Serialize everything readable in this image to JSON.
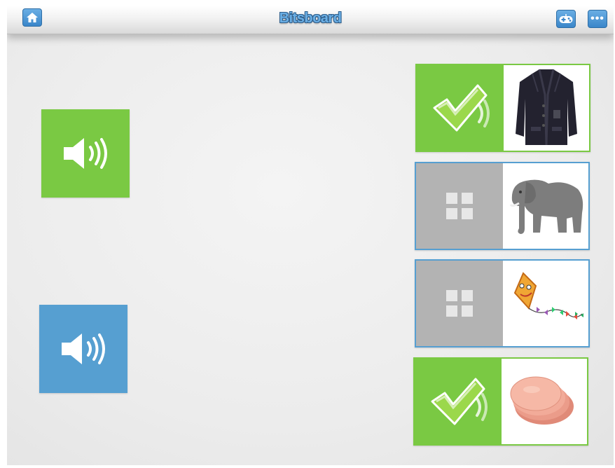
{
  "app": {
    "title": "Bitsboard",
    "toolbar": {
      "home_icon": "home-icon",
      "game_icon": "gamepad-icon",
      "more_icon": "ellipsis-icon",
      "more_label": "•••"
    }
  },
  "colors": {
    "accent_green": "#7ac943",
    "accent_blue": "#569fd1",
    "pending_gray": "#b3b3b3",
    "toolbar_blue": "#4a93d4"
  },
  "sound_buttons": [
    {
      "icon": "speaker-icon",
      "color": "green"
    },
    {
      "icon": "speaker-icon",
      "color": "blue"
    }
  ],
  "answer_cards": [
    {
      "subject": "jacket",
      "state": "correct",
      "status_icon": "checkmark-icon"
    },
    {
      "subject": "elephant",
      "state": "pending",
      "status_icon": "grid-icon"
    },
    {
      "subject": "kite",
      "state": "pending",
      "status_icon": "grid-icon"
    },
    {
      "subject": "ham",
      "state": "correct",
      "status_icon": "checkmark-icon"
    }
  ]
}
